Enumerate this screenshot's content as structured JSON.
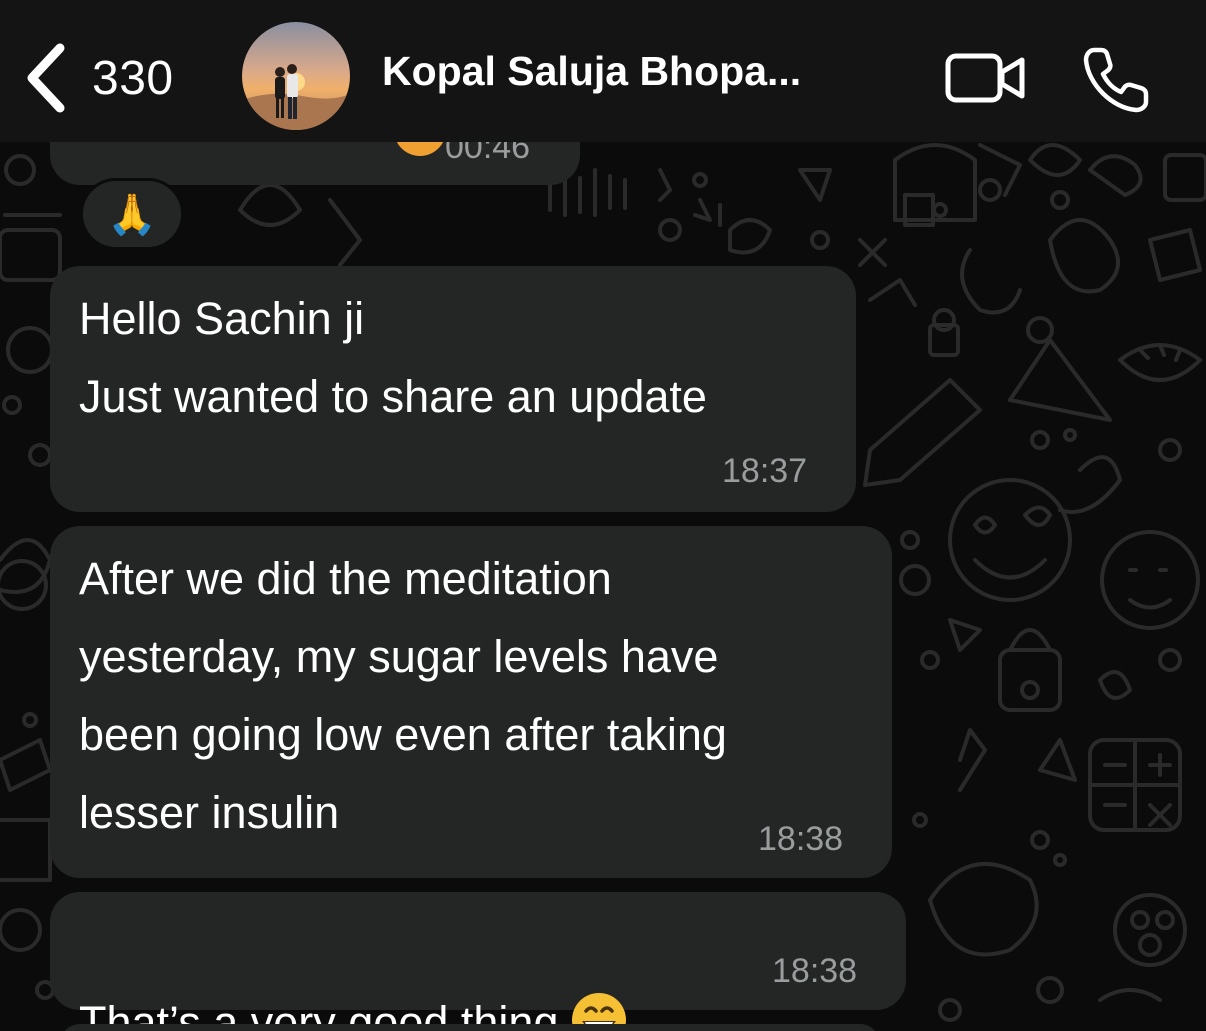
{
  "header": {
    "back_count": "330",
    "contact_name": "Kopal Saluja Bhopa...",
    "icons": {
      "back": "chevron-left-icon",
      "video": "video-camera-icon",
      "call": "phone-icon"
    }
  },
  "messages": [
    {
      "id": "partial",
      "text": "",
      "time": "00:46",
      "reaction": "🙏"
    },
    {
      "id": "m1",
      "text": "Hello Sachin ji\nJust wanted to share an update",
      "time": "18:37"
    },
    {
      "id": "m2",
      "text": "After we did the meditation\nyesterday, my sugar levels have\nbeen going low even after taking\nlesser insulin",
      "time": "18:38"
    },
    {
      "id": "m3",
      "text": "That’s a very good thing",
      "time": "18:38",
      "emoji": "grinning-face-icon"
    }
  ],
  "colors": {
    "background": "#0b0b0b",
    "header": "#141414",
    "bubble": "#242626",
    "timestamp": "#9a9d9d"
  }
}
